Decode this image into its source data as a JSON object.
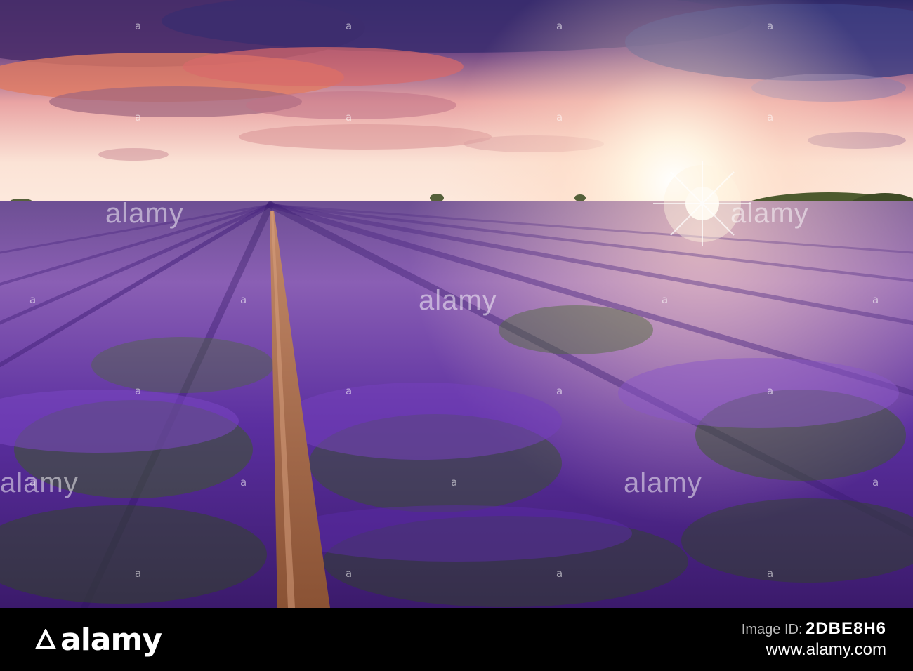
{
  "photo": {
    "description_subject": "lavender-field-sunset"
  },
  "watermark": {
    "tile_text": "a",
    "center_text": "alamy"
  },
  "footer": {
    "brand": "alamy",
    "image_id_label": "Image ID:",
    "image_id": "2DBE8H6",
    "site": "www.alamy.com"
  },
  "colors": {
    "sky_top": "#3a2a6e",
    "sky_glow": "#fbe7d8",
    "sun": "#fff7e6",
    "field": "#6a3aa8",
    "path": "#9c5e3c",
    "footer_bg": "#000000"
  }
}
